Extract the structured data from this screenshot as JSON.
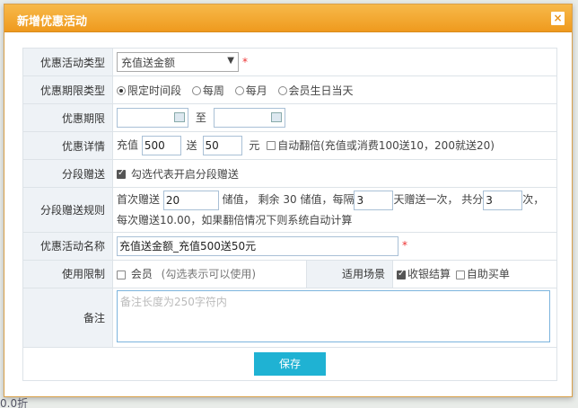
{
  "dialog": {
    "title": "新增优惠活动",
    "close_icon": "×"
  },
  "labels": {
    "type": "优惠活动类型",
    "period_type": "优惠期限类型",
    "period": "优惠期限",
    "detail": "优惠详情",
    "segment": "分段赠送",
    "segment_rule": "分段赠送规则",
    "name": "优惠活动名称",
    "limit": "使用限制",
    "scene": "适用场景",
    "remark": "备注"
  },
  "type_select": {
    "value": "充值送金额",
    "required": "*"
  },
  "period_options": [
    {
      "label": "限定时间段",
      "checked": true
    },
    {
      "label": "每周",
      "checked": false
    },
    {
      "label": "每月",
      "checked": false
    },
    {
      "label": "会员生日当天",
      "checked": false
    }
  ],
  "period_to": "至",
  "detail": {
    "prefix": "充值",
    "recharge": "500",
    "mid": "送",
    "gift": "50",
    "unit": "元",
    "auto_double": "自动翻倍(充值或消费100送10，200就送20)"
  },
  "segment": {
    "label": "勾选代表开启分段赠送"
  },
  "segment_rule": {
    "first_label": "首次赠送",
    "first": "20",
    "t1": "储值，  剩余",
    "remain": "30",
    "t2": "储值，每隔",
    "interval": "3",
    "t3": "天赠送一次，  共分",
    "parts": "3",
    "t4": "次，",
    "line2": "每次赠送10.00，如果翻倍情况下则系统自动计算"
  },
  "name": {
    "value": "充值送金额_充值500送50元",
    "required": "*"
  },
  "limit": {
    "member": "会员",
    "note": "(勾选表示可以使用)"
  },
  "scene": [
    {
      "label": "收银结算",
      "checked": true
    },
    {
      "label": "自助买单",
      "checked": false
    }
  ],
  "remark": {
    "placeholder": "备注长度为250字符内"
  },
  "save_label": "保存",
  "background_text": "0.0折"
}
